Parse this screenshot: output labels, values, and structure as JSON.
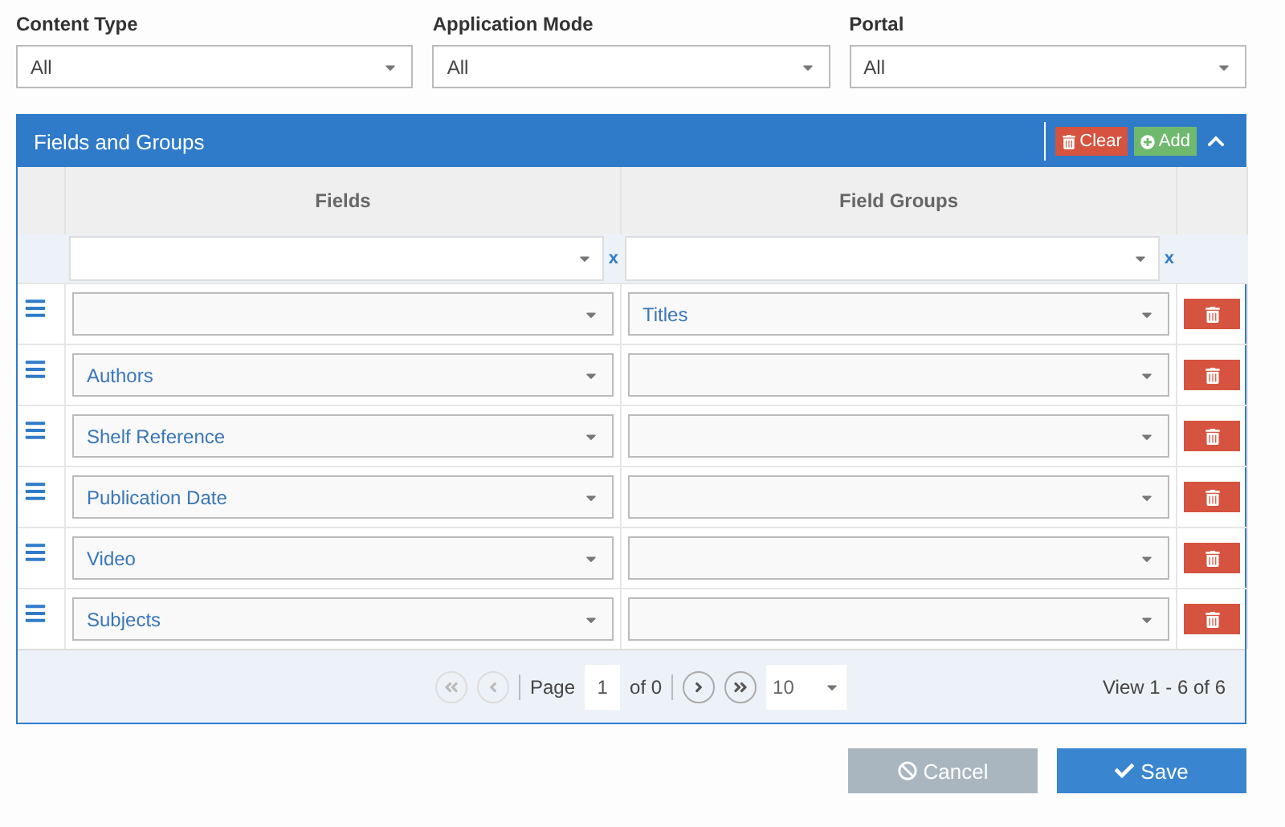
{
  "filters": [
    {
      "label": "Content Type",
      "value": "All"
    },
    {
      "label": "Application Mode",
      "value": "All"
    },
    {
      "label": "Portal",
      "value": "All"
    }
  ],
  "panel": {
    "title": "Fields and Groups",
    "clear_button": "Clear",
    "add_button": "Add",
    "expanded": true
  },
  "table": {
    "columns": [
      "Fields",
      "Field Groups"
    ],
    "filter_clear": [
      "x",
      "x"
    ],
    "rows": [
      {
        "field": "",
        "group": "Titles"
      },
      {
        "field": "Authors",
        "group": ""
      },
      {
        "field": "Shelf Reference",
        "group": ""
      },
      {
        "field": "Publication Date",
        "group": ""
      },
      {
        "field": "Video",
        "group": ""
      },
      {
        "field": "Subjects",
        "group": ""
      }
    ]
  },
  "pager": {
    "first_disabled": true,
    "prev_disabled": true,
    "next_disabled": false,
    "last_disabled": false,
    "page_label": "Page",
    "page": "1",
    "of": "of 0",
    "page_size": "10",
    "view": "View 1 - 6 of 6"
  },
  "buttons": [
    {
      "label": "Cancel",
      "kind": "cancel",
      "disabled": true
    },
    {
      "label": "Save",
      "kind": "save",
      "disabled": false
    }
  ]
}
